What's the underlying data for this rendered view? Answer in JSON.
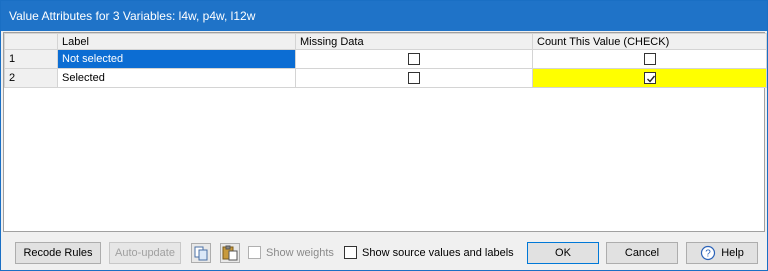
{
  "window": {
    "title": "Value Attributes for 3 Variables: l4w, p4w, l12w"
  },
  "grid": {
    "columns": [
      "",
      "Label",
      "Missing Data",
      "Count This Value (CHECK)"
    ],
    "rows": [
      {
        "num": "1",
        "label": "Not selected",
        "missing": false,
        "count": false
      },
      {
        "num": "2",
        "label": "Selected",
        "missing": false,
        "count": true
      }
    ]
  },
  "toolbar": {
    "recode_rules": "Recode Rules",
    "auto_update": "Auto-update",
    "show_weights": "Show weights",
    "show_source": "Show source values and labels",
    "ok": "OK",
    "cancel": "Cancel",
    "help": "Help"
  },
  "colors": {
    "title_bar": "#1f73c8",
    "selected_row": "#0c6dd3",
    "highlight": "#ffff00"
  }
}
